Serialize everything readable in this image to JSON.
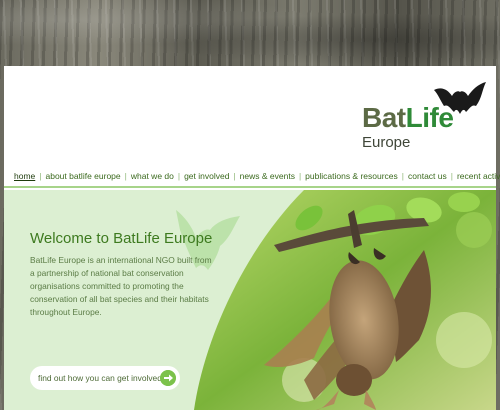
{
  "brand": {
    "logo_part1": "Bat",
    "logo_part2": "Life",
    "logo_sub": "Europe"
  },
  "nav": {
    "items": [
      {
        "label": "home"
      },
      {
        "label": "about batlife europe"
      },
      {
        "label": "what we do"
      },
      {
        "label": "get involved"
      },
      {
        "label": "news & events"
      },
      {
        "label": "publications & resources"
      },
      {
        "label": "contact us"
      },
      {
        "label": "recent activity"
      }
    ]
  },
  "hero": {
    "title": "Welcome to BatLife Europe",
    "text": "BatLife Europe is an international NGO built from a partnership of national bat conservation organisations committed to promoting the conservation of all bat species and their habitats throughout Europe.",
    "cta_label": "find out how you can get involved"
  },
  "colors": {
    "accent": "#3d7a1f",
    "nav_border": "#a7d48a",
    "hero_bg": "#dcefd2"
  },
  "icons": {
    "logo_bat": "bat-silhouette-icon",
    "cta_arrow": "arrow-right-icon"
  }
}
